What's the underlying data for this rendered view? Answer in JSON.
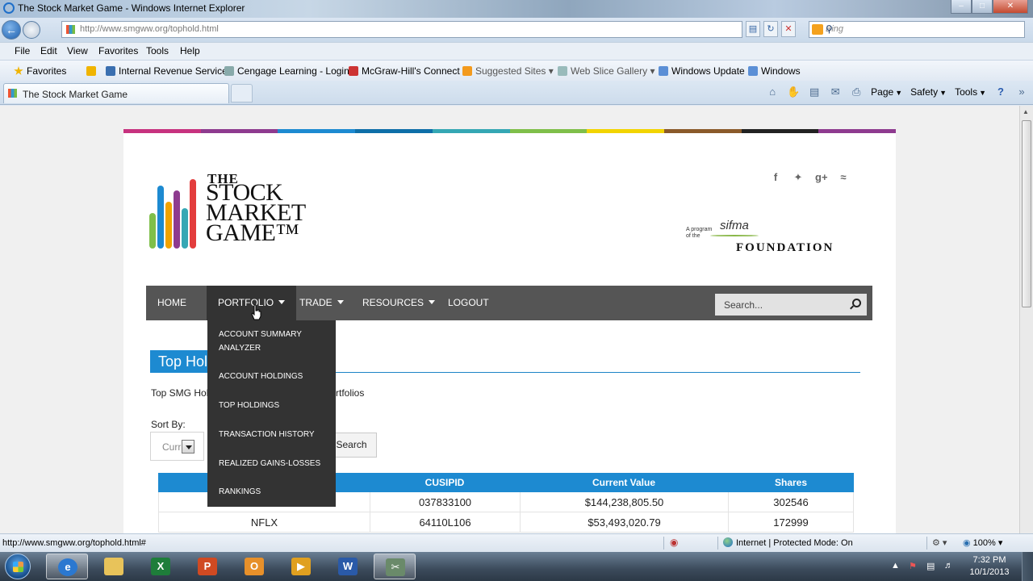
{
  "window": {
    "title": "The Stock Market Game - Windows Internet Explorer"
  },
  "address_bar": {
    "url": "http://www.smgww.org/tophold.html",
    "search_placeholder": "Bing"
  },
  "menu_bar": [
    "File",
    "Edit",
    "View",
    "Favorites",
    "Tools",
    "Help"
  ],
  "favorites_bar": {
    "favorites_label": "Favorites",
    "items": [
      "Internal Revenue Service",
      "Cengage Learning - Login",
      "McGraw-Hill's Connect",
      "Suggested Sites ▾",
      "Web Slice Gallery ▾",
      "Windows Update",
      "Windows"
    ]
  },
  "tab": {
    "title": "The Stock Market Game"
  },
  "command_bar": {
    "page": "Page",
    "safety": "Safety",
    "tools": "Tools"
  },
  "site": {
    "logo": {
      "the": "THE",
      "line1": "STOCK",
      "line2": "MARKET",
      "line3": "GAME™"
    },
    "sifma": {
      "program": "A program of the",
      "name": "sifma",
      "foundation": "FOUNDATION"
    },
    "social_icons": [
      "facebook-icon",
      "twitter-icon",
      "google-plus-icon",
      "rss-icon"
    ],
    "nav": {
      "home": "HOME",
      "portfolio": "PORTFOLIO",
      "trade": "TRADE",
      "resources": "RESOURCES",
      "logout": "LOGOUT",
      "search_placeholder": "Search..."
    },
    "portfolio_menu": [
      "ACCOUNT SUMMARY ANALYZER",
      "ACCOUNT HOLDINGS",
      "TOP HOLDINGS",
      "TRANSACTION HISTORY",
      "REALIZED GAINS-LOSSES",
      "RANKINGS"
    ],
    "heading": "Top Holdings",
    "subtext_left": "Top SMG Hol",
    "subtext_right": "rtfolios",
    "sort_by_label": "Sort By:",
    "sort_value": "Curr",
    "search_button": "Search",
    "table": {
      "columns": [
        "",
        "CUSIPID",
        "Current Value",
        "Shares"
      ],
      "rows": [
        [
          "",
          "037833100",
          "$144,238,805.50",
          "302546"
        ],
        [
          "NFLX",
          "64110L106",
          "$53,493,020.79",
          "172999"
        ]
      ]
    }
  },
  "status_bar": {
    "url": "http://www.smgww.org/tophold.html#",
    "zone": "Internet | Protected Mode: On",
    "zoom": "100%"
  },
  "taskbar": {
    "time": "7:32 PM",
    "date": "10/1/2013"
  },
  "colors": {
    "accent_blue": "#1d8ad1",
    "nav_gray": "#555555",
    "dropdown_dark": "#333333"
  }
}
